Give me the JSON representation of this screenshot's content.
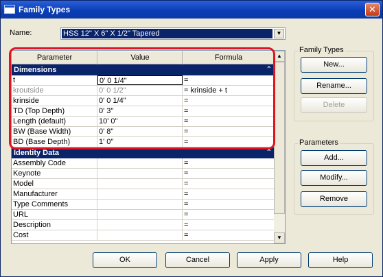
{
  "window": {
    "title": "Family Types",
    "close_glyph": "✕"
  },
  "name_field": {
    "label": "Name:",
    "value": "HSS 12\" X 6\" X 1/2\" Tapered"
  },
  "grid": {
    "headers": [
      "Parameter",
      "Value",
      "Formula"
    ],
    "groups": [
      {
        "title": "Dimensions",
        "rows": [
          {
            "param": "t",
            "value": "0'  0 1/4\"",
            "formula": "="
          },
          {
            "param": "kroutside",
            "value": "0'  0 1/2\"",
            "formula": "= krinside + t"
          },
          {
            "param": "krinside",
            "value": "0'  0 1/4\"",
            "formula": "="
          },
          {
            "param": "TD (Top Depth)",
            "value": "0'  3\"",
            "formula": "="
          },
          {
            "param": "Length (default)",
            "value": "10'  0\"",
            "formula": "="
          },
          {
            "param": "BW (Base Width)",
            "value": "0'  8\"",
            "formula": "="
          },
          {
            "param": "BD (Base Depth)",
            "value": "1'  0\"",
            "formula": "="
          }
        ]
      },
      {
        "title": "Identity Data",
        "rows": [
          {
            "param": "Assembly Code",
            "value": "",
            "formula": "="
          },
          {
            "param": "Keynote",
            "value": "",
            "formula": "="
          },
          {
            "param": "Model",
            "value": "",
            "formula": "="
          },
          {
            "param": "Manufacturer",
            "value": "",
            "formula": "="
          },
          {
            "param": "Type Comments",
            "value": "",
            "formula": "="
          },
          {
            "param": "URL",
            "value": "",
            "formula": "="
          },
          {
            "param": "Description",
            "value": "",
            "formula": "="
          },
          {
            "param": "Cost",
            "value": "",
            "formula": "="
          }
        ]
      }
    ],
    "collapse_glyph": "⌃"
  },
  "family_types_panel": {
    "legend": "Family Types",
    "new_label": "New...",
    "rename_label": "Rename...",
    "delete_label": "Delete"
  },
  "parameters_panel": {
    "legend": "Parameters",
    "add_label": "Add...",
    "modify_label": "Modify...",
    "remove_label": "Remove"
  },
  "footer": {
    "ok_label": "OK",
    "cancel_label": "Cancel",
    "apply_label": "Apply",
    "help_label": "Help"
  },
  "icons": {
    "dropdown_arrow": "▼",
    "scroll_up": "▲",
    "scroll_down": "▼"
  }
}
